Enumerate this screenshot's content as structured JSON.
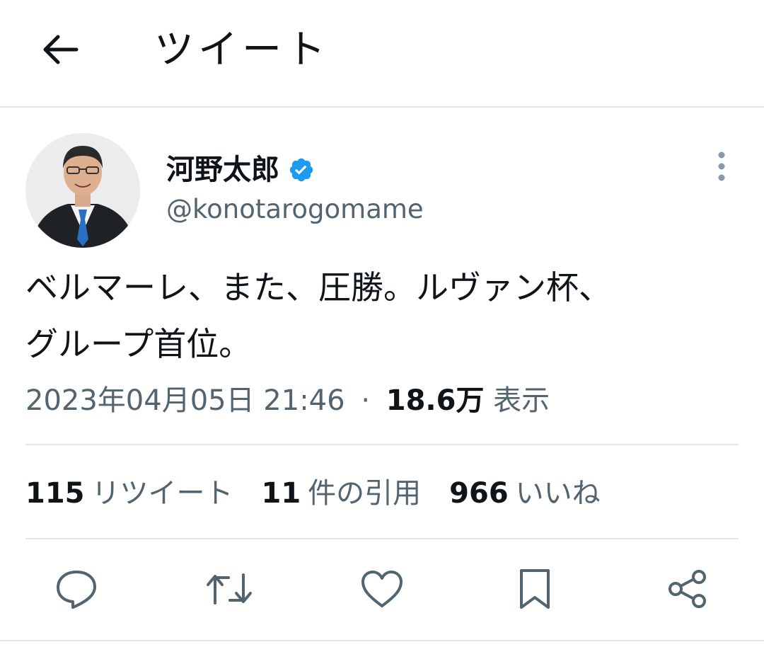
{
  "header": {
    "title": "ツイート",
    "back_icon": "arrow-left-icon"
  },
  "author": {
    "display_name": "河野太郎",
    "handle": "@konotarogomame",
    "verified_badge_color": "#1d9bf0"
  },
  "tweet": {
    "text": "ベルマーレ、また、圧勝。ルヴァン杯、\nグループ首位。",
    "timestamp": "2023年04月05日 21:46",
    "separator": "·",
    "views_count": "18.6万",
    "views_label": "表示"
  },
  "stats": {
    "retweets_count": "115",
    "retweets_label": "リツイート",
    "quotes_count": "11",
    "quotes_label": "件の引用",
    "likes_count": "966",
    "likes_label": "いいね"
  },
  "actions": [
    "reply-icon",
    "retweet-icon",
    "like-icon",
    "bookmark-icon",
    "share-icon"
  ],
  "colors": {
    "text": "#0f1419",
    "secondary": "#536471",
    "divider": "#e1e6ea",
    "icon": "#536471"
  }
}
